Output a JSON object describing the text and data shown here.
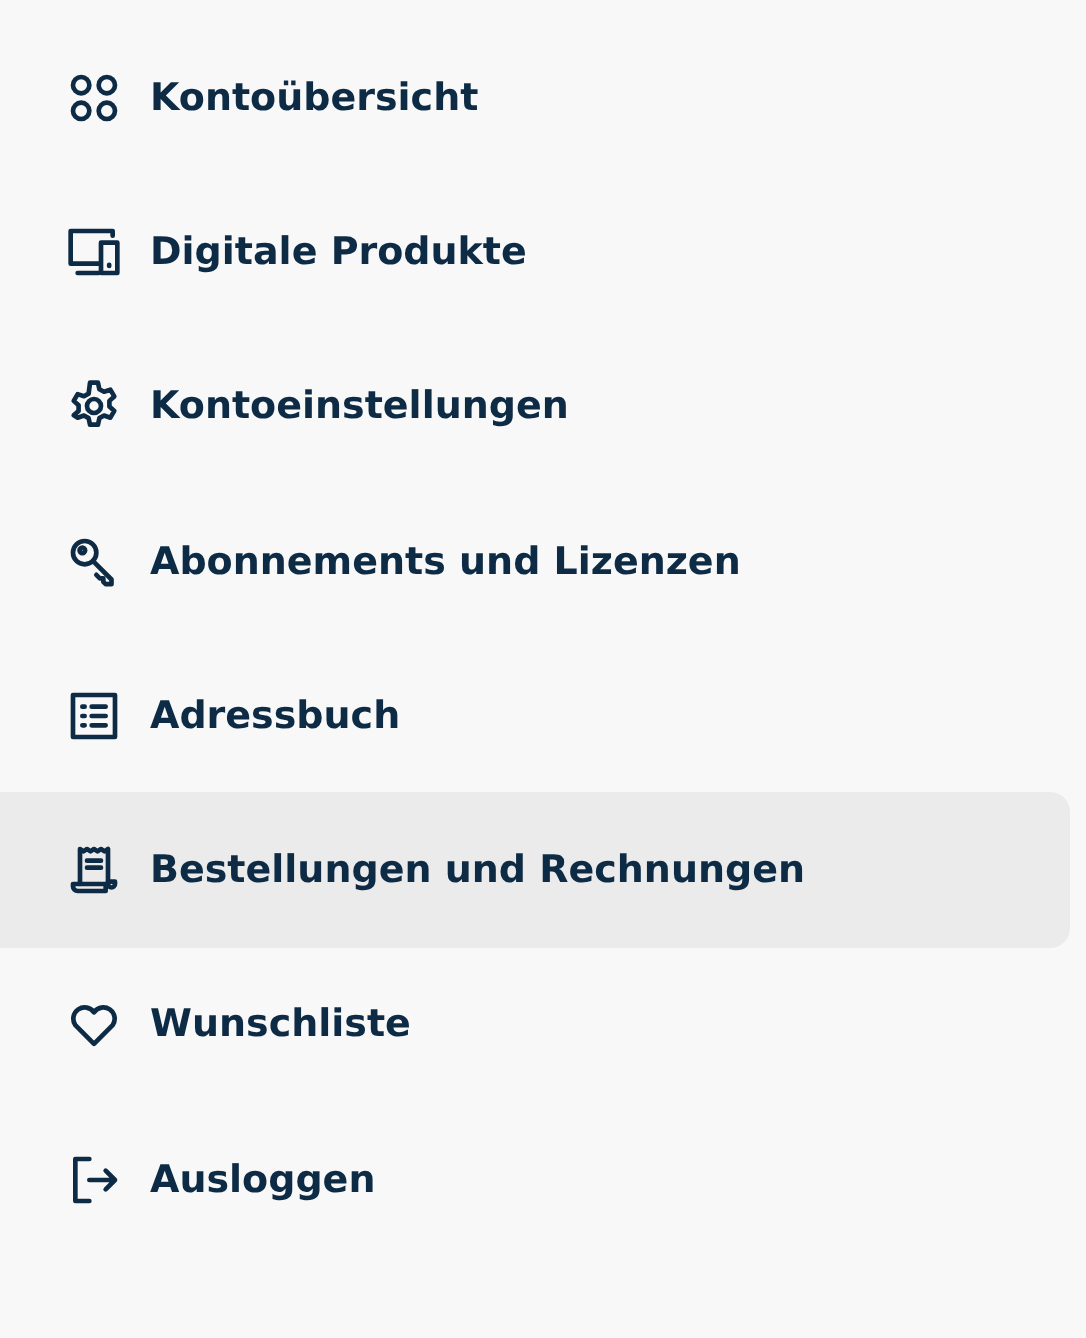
{
  "menu": {
    "items": [
      {
        "label": "Kontoübersicht",
        "selected": false
      },
      {
        "label": "Digitale Produkte",
        "selected": false
      },
      {
        "label": "Kontoeinstellungen",
        "selected": false
      },
      {
        "label": "Abonnements und Lizenzen",
        "selected": false
      },
      {
        "label": "Adressbuch",
        "selected": false
      },
      {
        "label": "Bestellungen und Rechnungen",
        "selected": true
      },
      {
        "label": "Wunschliste",
        "selected": false
      },
      {
        "label": "Ausloggen",
        "selected": false
      }
    ]
  }
}
